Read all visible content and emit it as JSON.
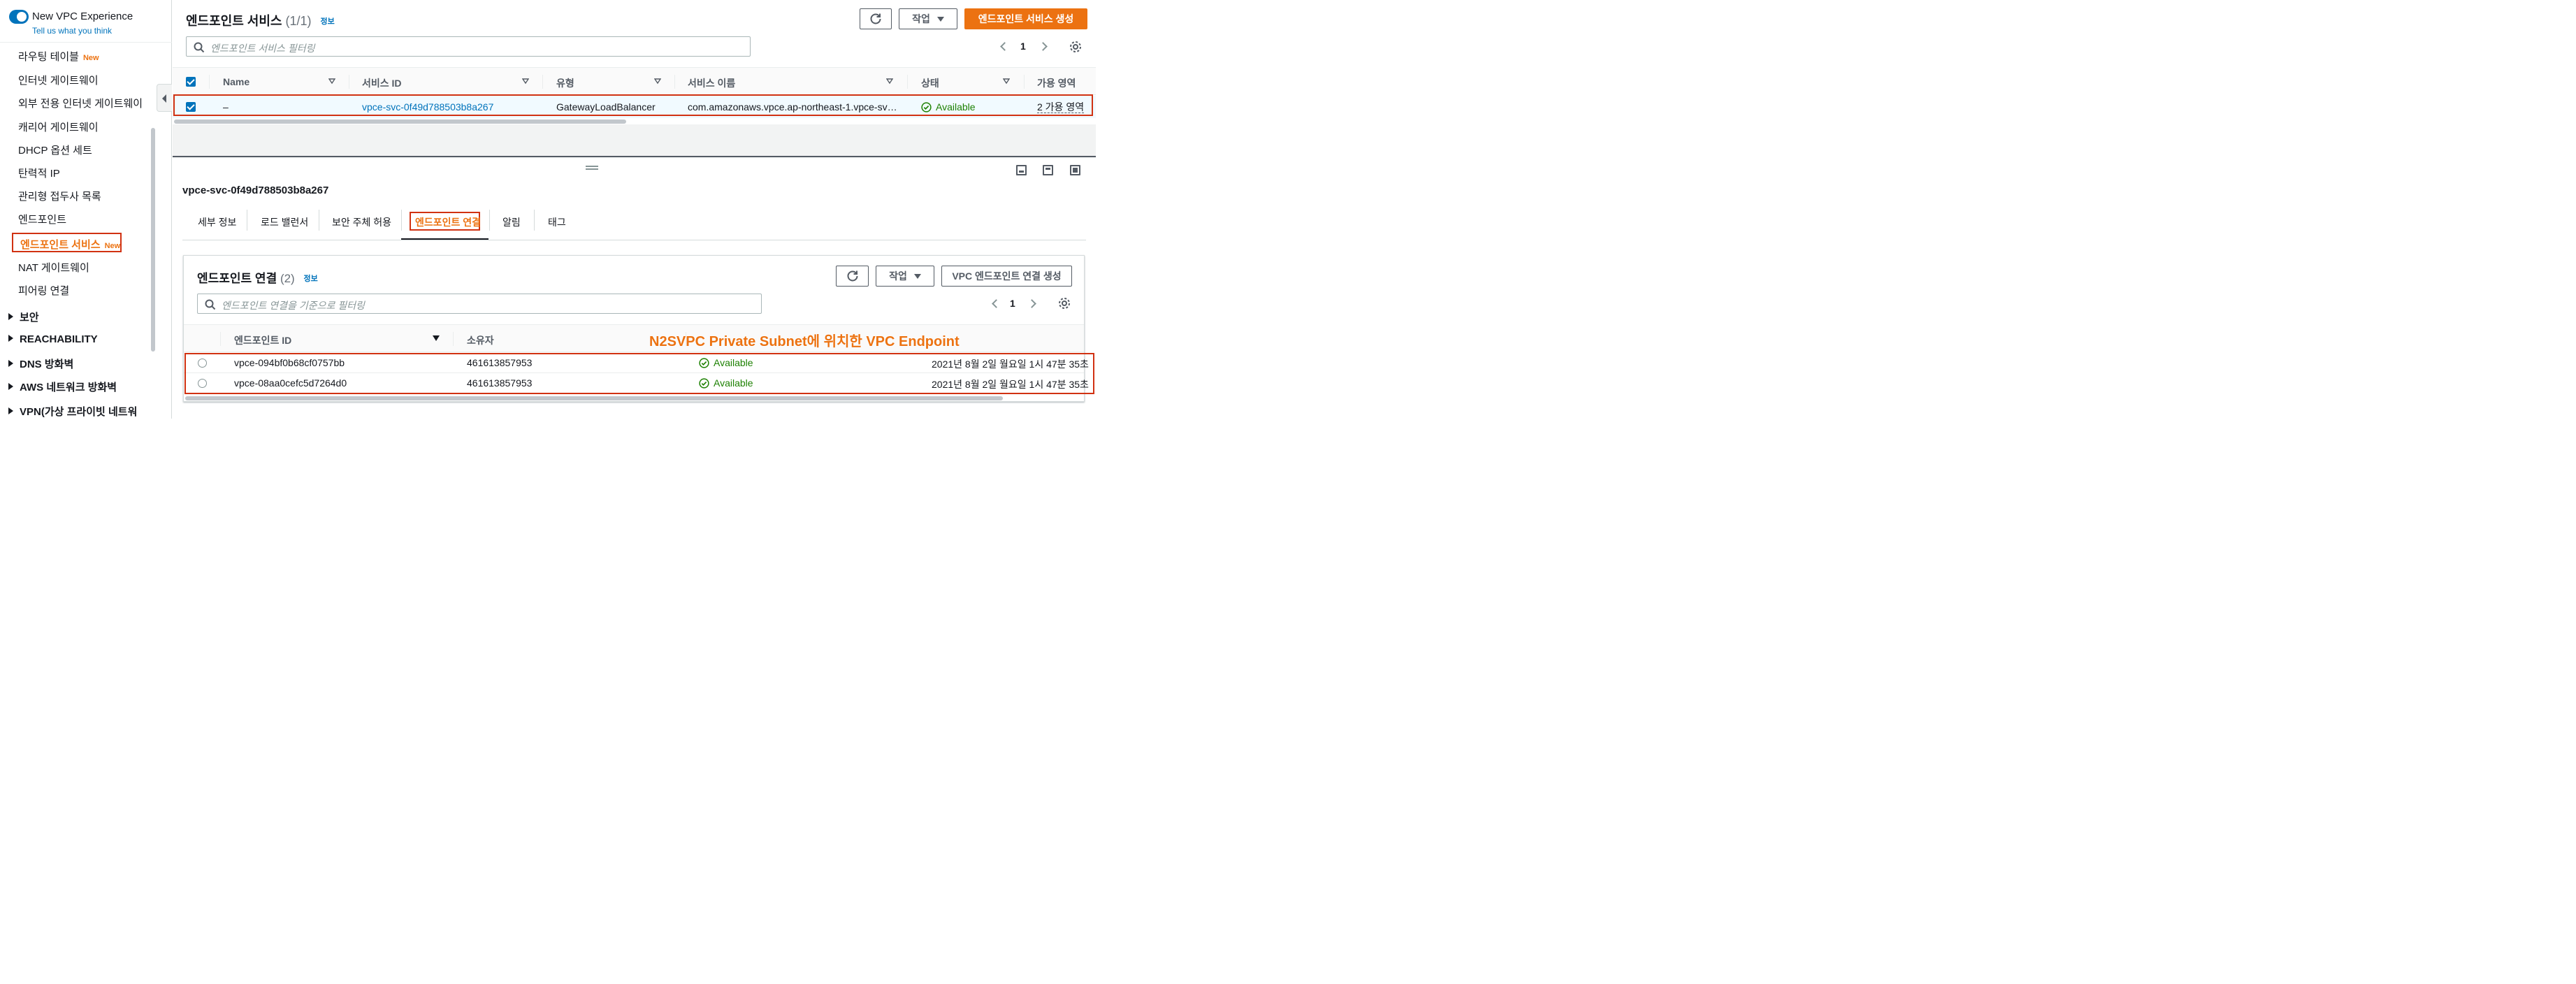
{
  "sidebar": {
    "experience_title": "New VPC Experience",
    "feedback_link": "Tell us what you think",
    "items": [
      {
        "label": "라우팅 테이블",
        "badge": "New"
      },
      {
        "label": "인터넷 게이트웨이"
      },
      {
        "label": "외부 전용 인터넷 게이트웨이"
      },
      {
        "label": "캐리어 게이트웨이"
      },
      {
        "label": "DHCP 옵션 세트"
      },
      {
        "label": "탄력적 IP"
      },
      {
        "label": "관리형 접두사 목록"
      },
      {
        "label": "엔드포인트"
      },
      {
        "label": "엔드포인트 서비스",
        "badge": "New",
        "active": true
      },
      {
        "label": "NAT 게이트웨이"
      },
      {
        "label": "피어링 연결"
      }
    ],
    "groups": [
      "보안",
      "REACHABILITY",
      "DNS 방화벽",
      "AWS 네트워크 방화벽",
      "VPN(가상 프라이빗 네트워"
    ]
  },
  "services_panel": {
    "title": "엔드포인트 서비스",
    "count": "(1/1)",
    "info": "정보",
    "refresh_icon": "refresh-icon",
    "actions_label": "작업",
    "create_label": "엔드포인트 서비스 생성",
    "filter_placeholder": "엔드포인트 서비스 필터링",
    "page": "1",
    "columns": [
      "Name",
      "서비스 ID",
      "유형",
      "서비스 이름",
      "상태",
      "가용 영역"
    ],
    "rows": [
      {
        "name": "–",
        "service_id": "vpce-svc-0f49d788503b8a267",
        "type": "GatewayLoadBalancer",
        "service_name": "com.amazonaws.vpce.ap-northeast-1.vpce-sv…",
        "status": "Available",
        "az": "2 가용 영역",
        "selected": true
      }
    ]
  },
  "detail": {
    "title": "vpce-svc-0f49d788503b8a267",
    "tabs": [
      "세부 정보",
      "로드 밸런서",
      "보안 주체 허용",
      "엔드포인트 연결",
      "알림",
      "태그"
    ],
    "active_tab": "엔드포인트 연결",
    "connections": {
      "title": "엔드포인트 연결",
      "count": "(2)",
      "info": "정보",
      "actions_label": "작업",
      "create_label": "VPC 엔드포인트 연결 생성",
      "filter_placeholder": "엔드포인트 연결을 기준으로 필터링",
      "page": "1",
      "columns": [
        "엔드포인트 ID",
        "소유자"
      ],
      "rows": [
        {
          "endpoint_id": "vpce-094bf0b68cf0757bb",
          "owner": "461613857953",
          "status": "Available",
          "created": "2021년 8월 2일 월요일 1시 47분 35초"
        },
        {
          "endpoint_id": "vpce-08aa0cefc5d7264d0",
          "owner": "461613857953",
          "status": "Available",
          "created": "2021년 8월 2일 월요일 1시 47분 35초"
        }
      ]
    }
  },
  "annotation": "N2SVPC Private Subnet에 위치한 VPC Endpoint",
  "colors": {
    "accent": "#ec7211",
    "link": "#0073bb",
    "ok": "#1d8102",
    "highlight": "#d13212"
  }
}
